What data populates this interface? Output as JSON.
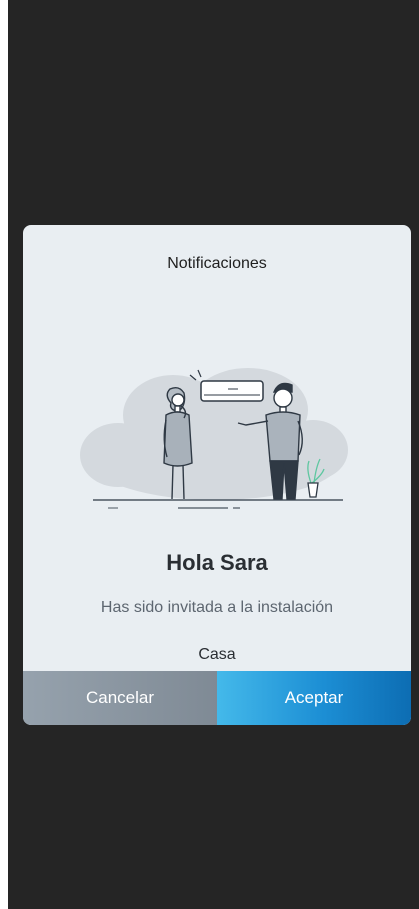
{
  "dialog": {
    "title": "Notificaciones",
    "greeting": "Hola Sara",
    "message": "Has sido invitada a la instalación",
    "installation_name": "Casa",
    "illustration": "air-conditioner-people-illustration"
  },
  "actions": {
    "cancel_label": "Cancelar",
    "accept_label": "Aceptar"
  },
  "colors": {
    "backdrop": "#252525",
    "dialog_background": "#e9eef2",
    "cancel_button": "#8b96a1",
    "accept_button": "#1c8ed4"
  }
}
